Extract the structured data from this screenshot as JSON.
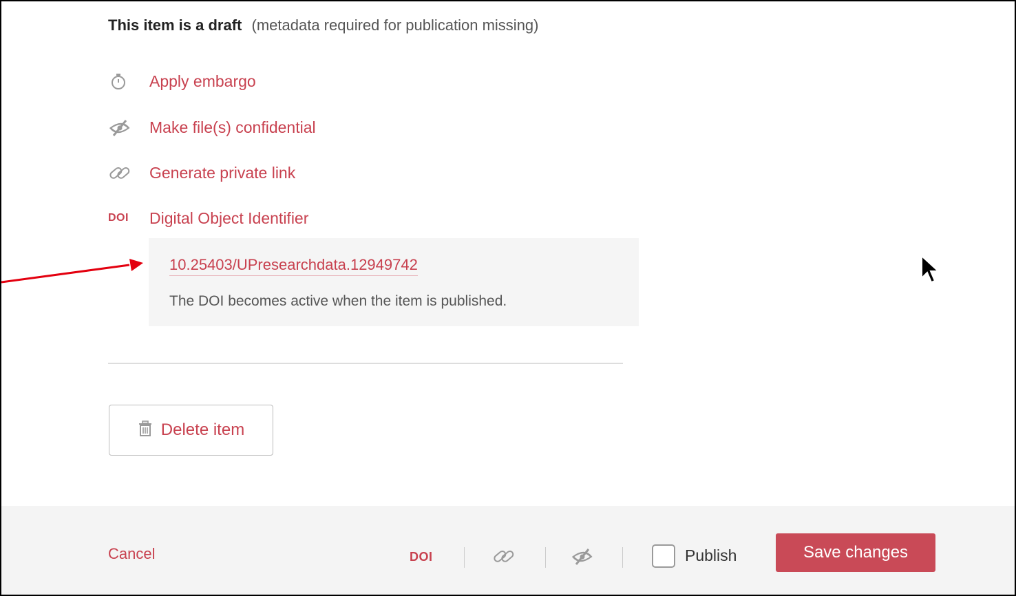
{
  "status": {
    "title": "This item is a draft",
    "note": "(metadata required for publication missing)"
  },
  "actions": [
    {
      "label": "Apply embargo",
      "icon": "stopwatch-icon"
    },
    {
      "label": "Make file(s) confidential",
      "icon": "eye-slash-icon"
    },
    {
      "label": "Generate private link",
      "icon": "link-icon"
    },
    {
      "label": "Digital Object Identifier",
      "icon": "doi-icon",
      "icon_text": "DOI"
    }
  ],
  "doi_panel": {
    "doi": "10.25403/UPresearchdata.12949742",
    "note": "The DOI becomes active when the item is published."
  },
  "delete_button": {
    "label": "Delete item",
    "icon": "trash-icon"
  },
  "footer": {
    "cancel_label": "Cancel",
    "doi_label": "DOI",
    "publish_label": "Publish",
    "publish_checked": false,
    "save_label": "Save changes"
  },
  "colors": {
    "accent": "#c8414f",
    "save_button": "#c94a57",
    "icon_gray": "#9a9a9a",
    "panel_bg": "#f5f5f5",
    "footer_bg": "#f4f4f4",
    "annotation_arrow": "#e3000f"
  }
}
